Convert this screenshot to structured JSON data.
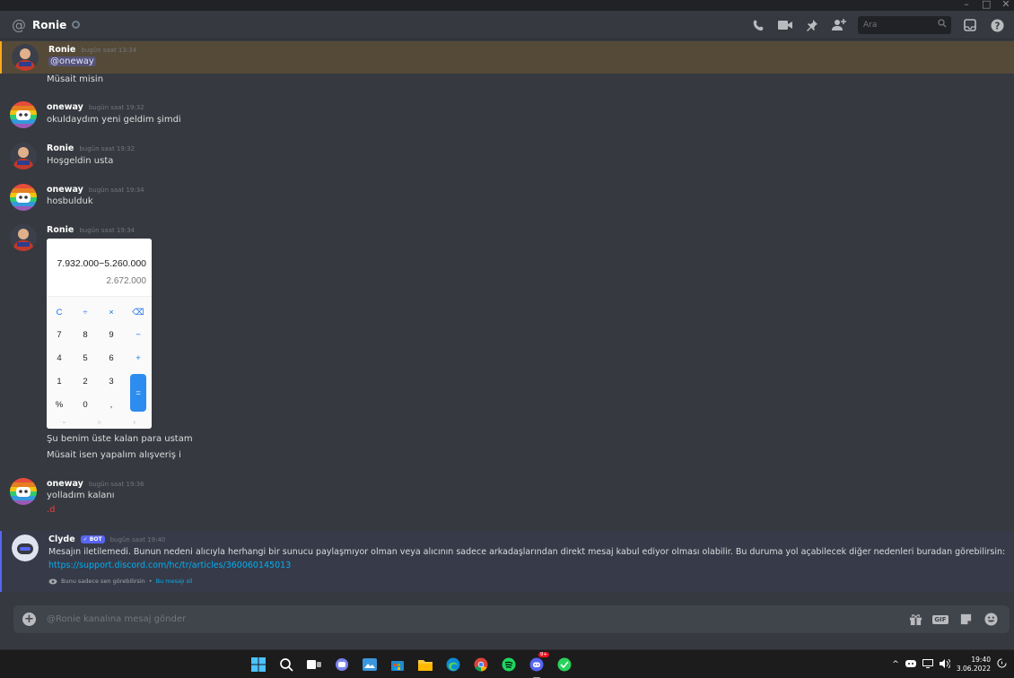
{
  "header": {
    "recipient": "Ronie",
    "search_placeholder": "Ara"
  },
  "messages": [
    {
      "author": "Ronie",
      "timestamp": "bugün saat 13:34",
      "mention": "@oneway",
      "lines": [
        "Müsait misin"
      ],
      "highlighted": true
    },
    {
      "author": "oneway",
      "timestamp": "bugün saat 19:32",
      "lines": [
        "okuldaydım yeni geldim şimdi"
      ]
    },
    {
      "author": "Ronie",
      "timestamp": "bugün saat 19:32",
      "lines": [
        "Hoşgeldin usta"
      ]
    },
    {
      "author": "oneway",
      "timestamp": "bugün saat 19:34",
      "lines": [
        "hosbulduk"
      ]
    },
    {
      "author": "Ronie",
      "timestamp": "bugün saat 19:34",
      "lines": [
        "Şu benim üste kalan para ustam",
        "Müsait isen yapalım alışveriş i"
      ],
      "attachment": {
        "expression": "7.932.000−5.260.000",
        "result": "2.672.000",
        "keys": [
          "C",
          "÷",
          "×",
          "⌫",
          "7",
          "8",
          "9",
          "−",
          "4",
          "5",
          "6",
          "+",
          "1",
          "2",
          "3",
          "=",
          "%",
          "0",
          ","
        ]
      }
    },
    {
      "author": "oneway",
      "timestamp": "bugün saat 19:36",
      "lines": [
        "yolladım kalanı",
        ".d"
      ]
    },
    {
      "author": "Clyde",
      "bot_tag": "✓ BOT",
      "timestamp": "bugün saat 19:40",
      "lines": [
        "Mesajın iletilemedi. Bunun nedeni alıcıyla herhangi bir sunucu paylaşmıyor olman veya alıcının sadece arkadaşlarından direkt mesaj kabul ediyor olması olabilir. Bu duruma yol açabilecek diğer nedenleri buradan görebilirsin:"
      ],
      "link": "https://support.discord.com/hc/tr/articles/360060145013",
      "ephemeral_note": "Bunu sadece sen görebilirsin",
      "ephemeral_sep": "•",
      "dismiss_label": "Bu mesajı sil"
    }
  ],
  "composer": {
    "placeholder": "@Ronie kanalına mesaj gönder",
    "gif_label": "GIF"
  },
  "taskbar": {
    "time": "19:40",
    "date": "3.06.2022",
    "discord_badge": "9+"
  },
  "colors": {
    "accent": "#5865f2",
    "mention_bar": "#faa81a",
    "link": "#00aff4"
  }
}
